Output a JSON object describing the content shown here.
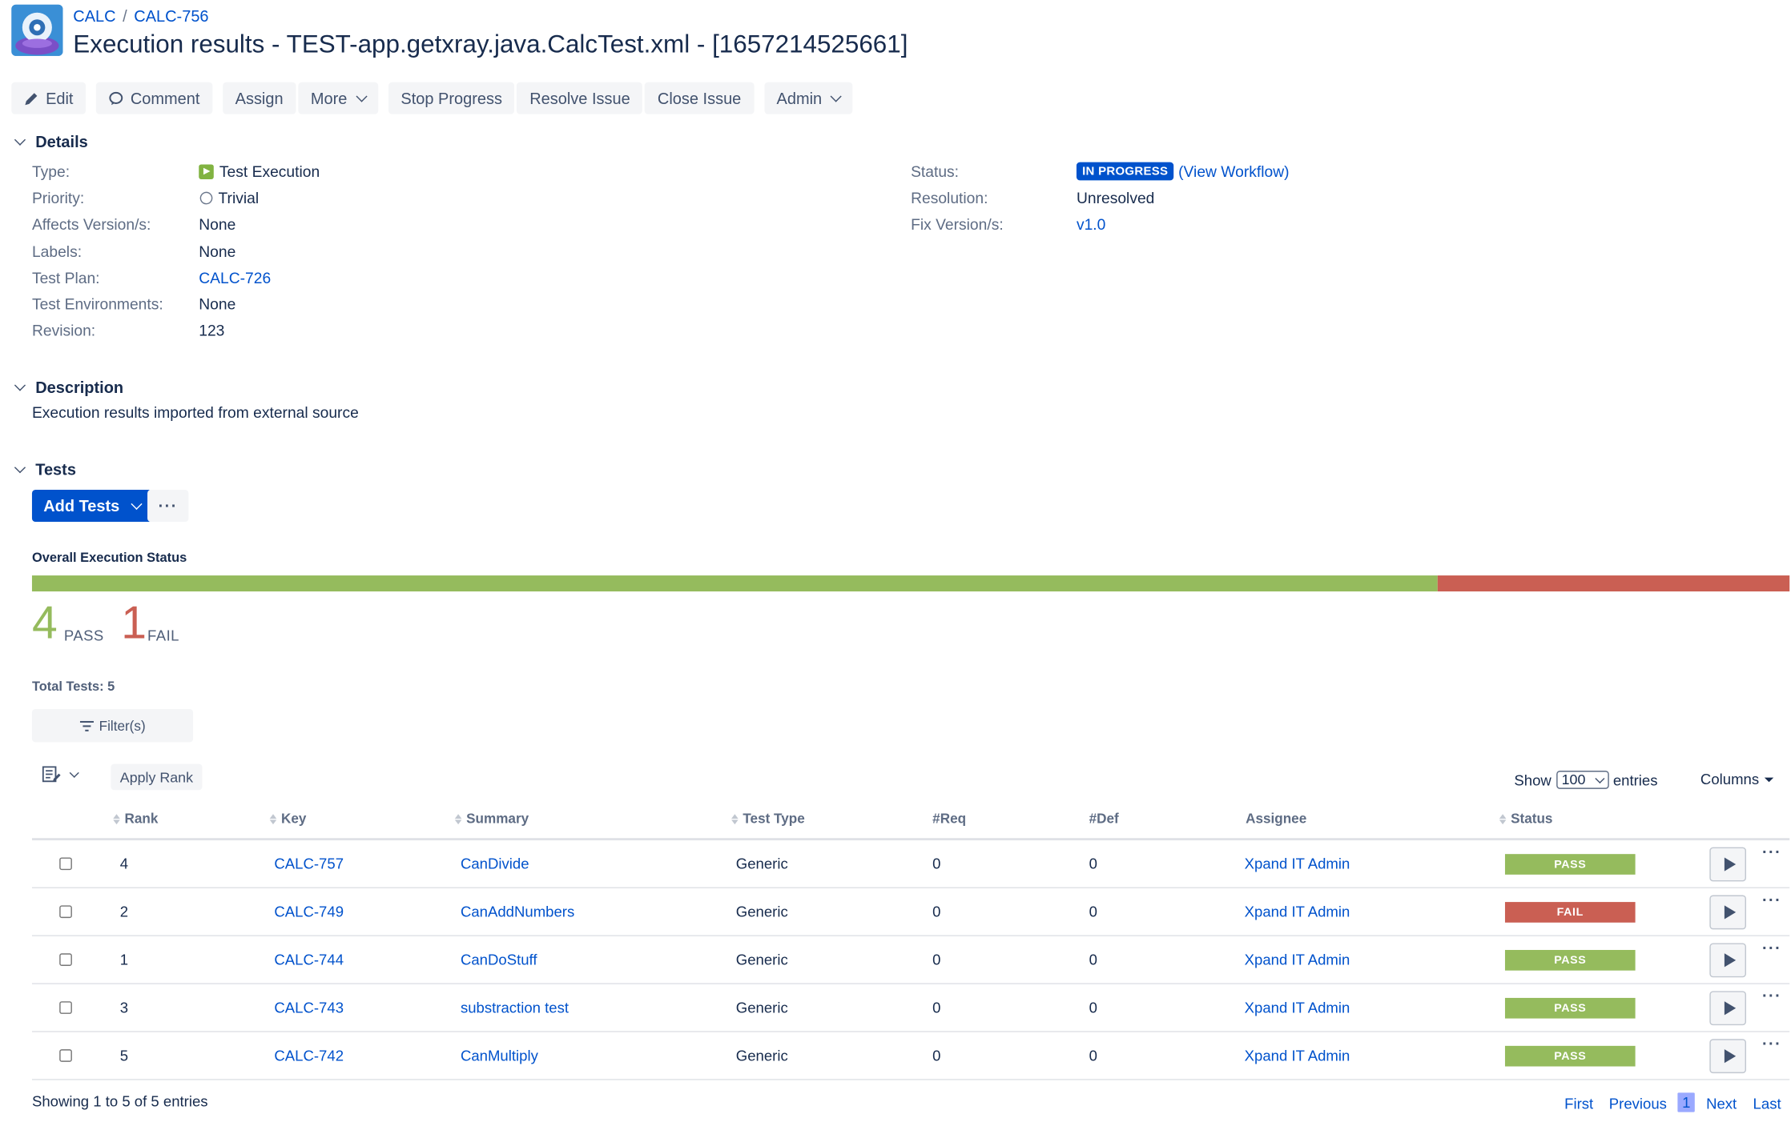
{
  "breadcrumb": {
    "project": "CALC",
    "issue": "CALC-756"
  },
  "title": "Execution results - TEST-app.getxray.java.CalcTest.xml - [1657214525661]",
  "toolbar": {
    "edit": "Edit",
    "comment": "Comment",
    "assign": "Assign",
    "more": "More",
    "stop_progress": "Stop Progress",
    "resolve": "Resolve Issue",
    "close": "Close Issue",
    "admin": "Admin"
  },
  "details": {
    "heading": "Details",
    "type_label": "Type:",
    "type_value": "Test Execution",
    "priority_label": "Priority:",
    "priority_value": "Trivial",
    "affects_label": "Affects Version/s:",
    "affects_value": "None",
    "labels_label": "Labels:",
    "labels_value": "None",
    "testplan_label": "Test Plan:",
    "testplan_value": "CALC-726",
    "testenv_label": "Test Environments:",
    "testenv_value": "None",
    "revision_label": "Revision:",
    "revision_value": "123",
    "status_label": "Status:",
    "status_value": "IN PROGRESS",
    "view_workflow": "(View Workflow)",
    "resolution_label": "Resolution:",
    "resolution_value": "Unresolved",
    "fix_label": "Fix Version/s:",
    "fix_value": "v1.0"
  },
  "description": {
    "heading": "Description",
    "text": "Execution results imported from external source"
  },
  "tests": {
    "heading": "Tests",
    "add_tests": "Add Tests",
    "more_dots": "···",
    "overall_status": "Overall Execution Status",
    "pass_fraction": 0.8,
    "pass_count": "4",
    "pass_label": "PASS",
    "fail_count": "1",
    "fail_label": "FAIL",
    "total": "Total Tests: 5",
    "filters": "Filter(s)",
    "apply_rank": "Apply Rank",
    "show": "Show",
    "show_value": "100",
    "entries": "entries",
    "columns": "Columns",
    "headers": {
      "rank": "Rank",
      "key": "Key",
      "summary": "Summary",
      "test_type": "Test Type",
      "req": "#Req",
      "def": "#Def",
      "assignee": "Assignee",
      "status": "Status"
    },
    "rows": [
      {
        "rank": "4",
        "key": "CALC-757",
        "summary": "CanDivide",
        "type": "Generic",
        "req": "0",
        "def": "0",
        "assignee": "Xpand IT Admin",
        "status": "PASS"
      },
      {
        "rank": "2",
        "key": "CALC-749",
        "summary": "CanAddNumbers",
        "type": "Generic",
        "req": "0",
        "def": "0",
        "assignee": "Xpand IT Admin",
        "status": "FAIL"
      },
      {
        "rank": "1",
        "key": "CALC-744",
        "summary": "CanDoStuff",
        "type": "Generic",
        "req": "0",
        "def": "0",
        "assignee": "Xpand IT Admin",
        "status": "PASS"
      },
      {
        "rank": "3",
        "key": "CALC-743",
        "summary": "substraction test",
        "type": "Generic",
        "req": "0",
        "def": "0",
        "assignee": "Xpand IT Admin",
        "status": "PASS"
      },
      {
        "rank": "5",
        "key": "CALC-742",
        "summary": "CanMultiply",
        "type": "Generic",
        "req": "0",
        "def": "0",
        "assignee": "Xpand IT Admin",
        "status": "PASS"
      }
    ],
    "showing": "Showing 1 to 5 of 5 entries",
    "pager": {
      "first": "First",
      "previous": "Previous",
      "current": "1",
      "next": "Next",
      "last": "Last"
    }
  },
  "colors": {
    "pass": "#95bb5d",
    "fail": "#ca5f53",
    "link": "#0052cc"
  }
}
